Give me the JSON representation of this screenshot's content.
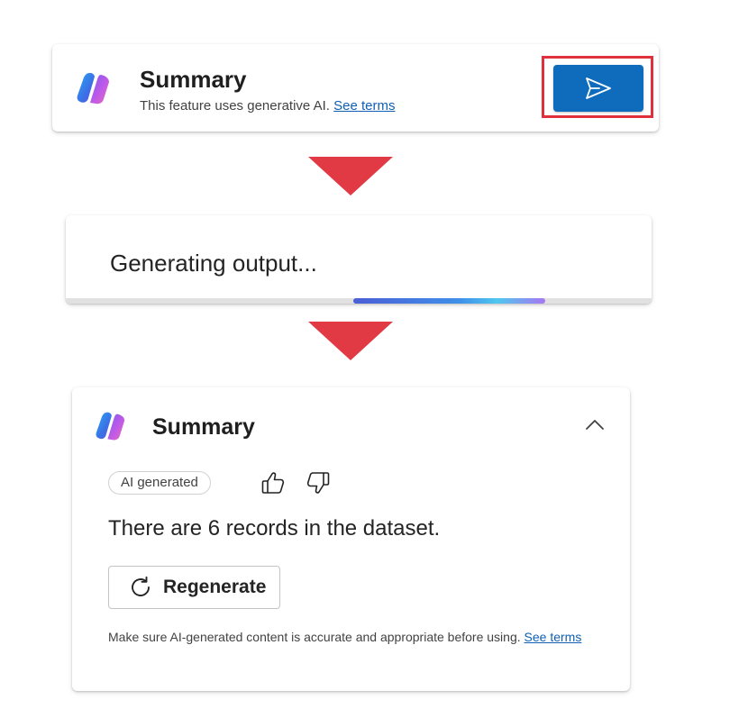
{
  "prompt_card": {
    "title": "Summary",
    "subtitle": "This feature uses generative AI.",
    "terms_link": "See terms",
    "send_icon": "send-icon"
  },
  "progress_card": {
    "status_text": "Generating output...",
    "progress": {
      "start": 0.491,
      "end": 0.818
    }
  },
  "result_card": {
    "title": "Summary",
    "badge": "AI generated",
    "result_text": "There are 6 records in the dataset.",
    "regenerate_label": "Regenerate",
    "disclaimer": "Make sure AI-generated content is accurate and appropriate before using.",
    "terms_link": "See terms"
  },
  "colors": {
    "accent": "#0f6cbd",
    "link": "#0f5fb3",
    "highlight": "#e0303b",
    "arrow": "#e23a45"
  }
}
